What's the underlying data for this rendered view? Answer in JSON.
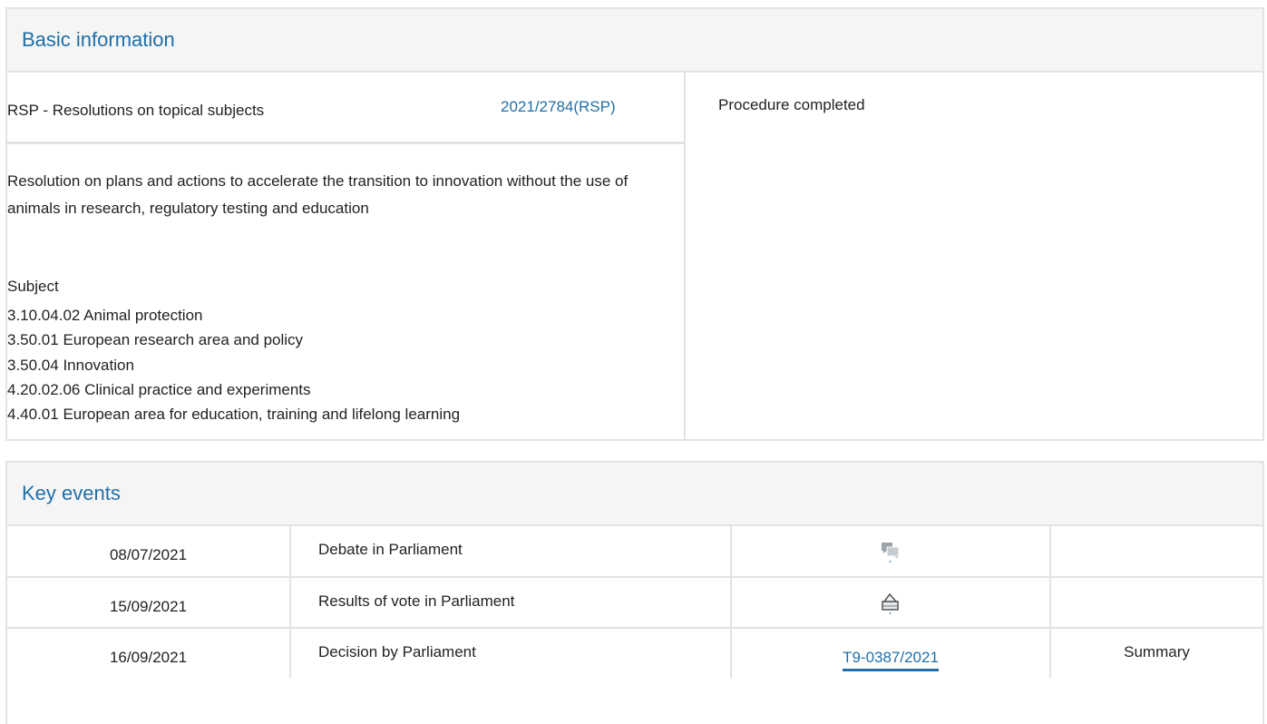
{
  "basic": {
    "heading": "Basic information",
    "procedure_type": "RSP - Resolutions on topical subjects",
    "procedure_ref": "2021/2784(RSP)",
    "status": "Procedure completed",
    "title": "Resolution on plans and actions to accelerate the transition to innovation without the use of animals in research, regulatory testing and education",
    "subject_heading": "Subject",
    "subjects": [
      "3.10.04.02 Animal protection",
      "3.50.01 European research area and policy",
      "3.50.04 Innovation",
      "4.20.02.06 Clinical practice and experiments",
      "4.40.01 European area for education, training and lifelong learning"
    ]
  },
  "events": {
    "heading": "Key events",
    "rows": [
      {
        "date": "08/07/2021",
        "event": "Debate in Parliament",
        "doc_icon": "debate-icon",
        "doc": "",
        "summary": ""
      },
      {
        "date": "15/09/2021",
        "event": "Results of vote in Parliament",
        "doc_icon": "vote-icon",
        "doc": "",
        "summary": ""
      },
      {
        "date": "16/09/2021",
        "event": "Decision by Parliament",
        "doc_icon": "",
        "doc": "T9-0387/2021",
        "summary": "Summary"
      }
    ]
  },
  "colors": {
    "accent": "#1f6fa8",
    "border": "#e3e3e3",
    "header_bg": "#f5f5f5"
  }
}
